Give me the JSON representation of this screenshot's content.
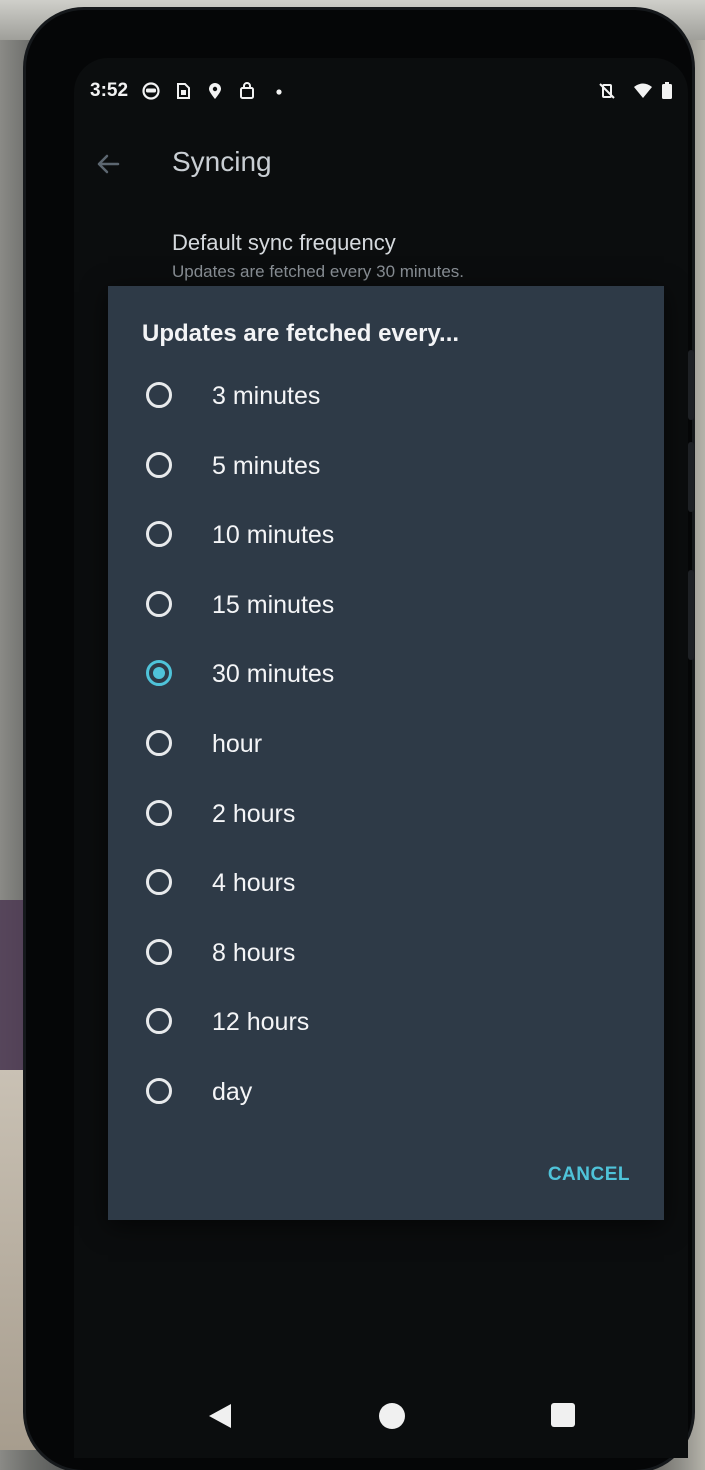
{
  "status_bar": {
    "time": "3:52",
    "icons": [
      "discord-icon",
      "sim-card-icon",
      "location-pin-icon",
      "shopping-bag-icon",
      "notification-dot-icon",
      "vibrate-off-icon",
      "wifi-icon",
      "battery-icon"
    ]
  },
  "app_bar": {
    "title": "Syncing",
    "back_icon": "arrow-left-icon"
  },
  "preference": {
    "title": "Default sync frequency",
    "summary": "Updates are fetched every 30 minutes."
  },
  "dialog": {
    "title": "Updates are fetched every...",
    "options": [
      {
        "label": "3 minutes",
        "selected": false
      },
      {
        "label": "5 minutes",
        "selected": false
      },
      {
        "label": "10 minutes",
        "selected": false
      },
      {
        "label": "15 minutes",
        "selected": false
      },
      {
        "label": "30 minutes",
        "selected": true
      },
      {
        "label": "hour",
        "selected": false
      },
      {
        "label": "2 hours",
        "selected": false
      },
      {
        "label": "4 hours",
        "selected": false
      },
      {
        "label": "8 hours",
        "selected": false
      },
      {
        "label": "12 hours",
        "selected": false
      },
      {
        "label": "day",
        "selected": false
      }
    ],
    "cancel_label": "CANCEL"
  },
  "colors": {
    "accent": "#4fc3d9",
    "dialog_bg": "#2e3a47",
    "screen_bg": "#0b0d0e"
  }
}
